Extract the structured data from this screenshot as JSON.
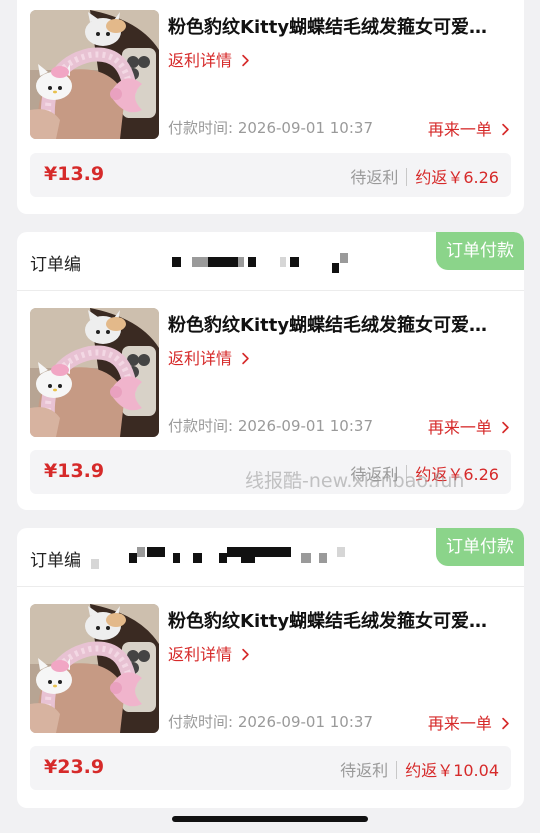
{
  "orders": [
    {
      "title": "粉色豹纹Kitty蝴蝶结毛绒发箍女可爱…",
      "rebate_link": "返利详情",
      "pay_time": "付款时间: 2026-09-01 10:37",
      "reorder": "再来一单",
      "price": "¥13.9",
      "pending": "待返利",
      "estimated": "约返￥6.26"
    },
    {
      "order_no_label": "订单编",
      "status": "订单付款",
      "title": "粉色豹纹Kitty蝴蝶结毛绒发箍女可爱…",
      "rebate_link": "返利详情",
      "pay_time": "付款时间: 2026-09-01 10:37",
      "reorder": "再来一单",
      "price": "¥13.9",
      "pending": "待返利",
      "estimated": "约返￥6.26"
    },
    {
      "order_no_label": "订单编",
      "status": "订单付款",
      "title": "粉色豹纹Kitty蝴蝶结毛绒发箍女可爱…",
      "rebate_link": "返利详情",
      "pay_time": "付款时间: 2026-09-01 10:37",
      "reorder": "再来一单",
      "price": "¥23.9",
      "pending": "待返利",
      "estimated": "约返￥10.04"
    }
  ],
  "watermark": "线报酷-new.xianbao.fun",
  "icons": {
    "chevron": "chevron-right-icon"
  },
  "colors": {
    "accent": "#d62a2a",
    "badge": "#8bd48a",
    "muted": "#9a9a9a"
  }
}
